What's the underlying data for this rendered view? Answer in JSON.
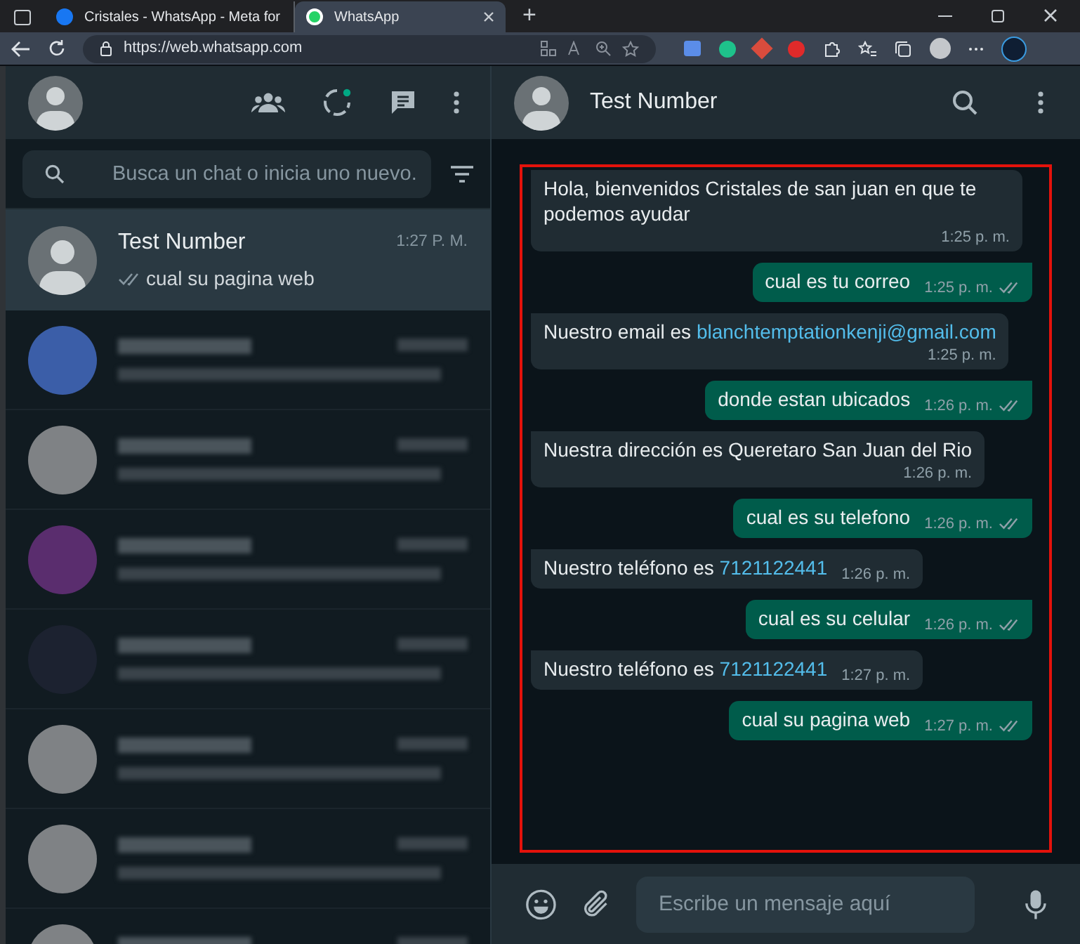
{
  "browser": {
    "tabs": [
      {
        "title": "Cristales - WhatsApp - Meta for",
        "selected": false
      },
      {
        "title": "WhatsApp",
        "selected": true
      }
    ],
    "new_tab": "+",
    "url": "https://web.whatsapp.com"
  },
  "sidebar": {
    "search": {
      "placeholder": "Busca un chat o inicia uno nuevo."
    },
    "chats": [
      {
        "kind": "clear",
        "name": "Test Number",
        "time": "1:27 P. M.",
        "preview": "cual su pagina web",
        "selected": true
      },
      {
        "kind": "blurred",
        "color": "#3b5ea8"
      },
      {
        "kind": "blurred",
        "color": "#7f8285"
      },
      {
        "kind": "blurred",
        "color": "#5a2d6e"
      },
      {
        "kind": "blurred",
        "color": "#1c2230"
      },
      {
        "kind": "blurred",
        "color": "#7f8285"
      },
      {
        "kind": "blurred",
        "color": "#7f8285"
      },
      {
        "kind": "blurred",
        "color": "#7f8285"
      }
    ]
  },
  "chat": {
    "title": "Test Number",
    "messages": [
      {
        "kind": "in",
        "text": "Hola, bienvenidos Cristales de san juan en que te podemos ayudar",
        "time": "1:25 p. m."
      },
      {
        "kind": "out",
        "text": "cual es tu correo",
        "time": "1:25 p. m."
      },
      {
        "kind": "in",
        "text": "Nuestro email es ",
        "link": "blanchtemptationkenji@gmail.com",
        "time": "1:25 p. m."
      },
      {
        "kind": "out",
        "text": "donde estan ubicados",
        "time": "1:26 p. m."
      },
      {
        "kind": "in",
        "text": "Nuestra dirección es Queretaro San Juan del Rio",
        "time": "1:26 p. m."
      },
      {
        "kind": "out",
        "text": "cual es su telefono",
        "time": "1:26 p. m."
      },
      {
        "kind": "in",
        "text": "Nuestro teléfono es ",
        "link": "7121122441",
        "time": "1:26 p. m."
      },
      {
        "kind": "out",
        "text": "cual es su celular",
        "time": "1:26 p. m."
      },
      {
        "kind": "in",
        "text": "Nuestro teléfono es ",
        "link": "7121122441",
        "time": "1:27 p. m."
      },
      {
        "kind": "out",
        "text": "cual su pagina web",
        "time": "1:27 p. m."
      }
    ],
    "composer": {
      "placeholder": "Escribe un mensaje aquí"
    }
  }
}
